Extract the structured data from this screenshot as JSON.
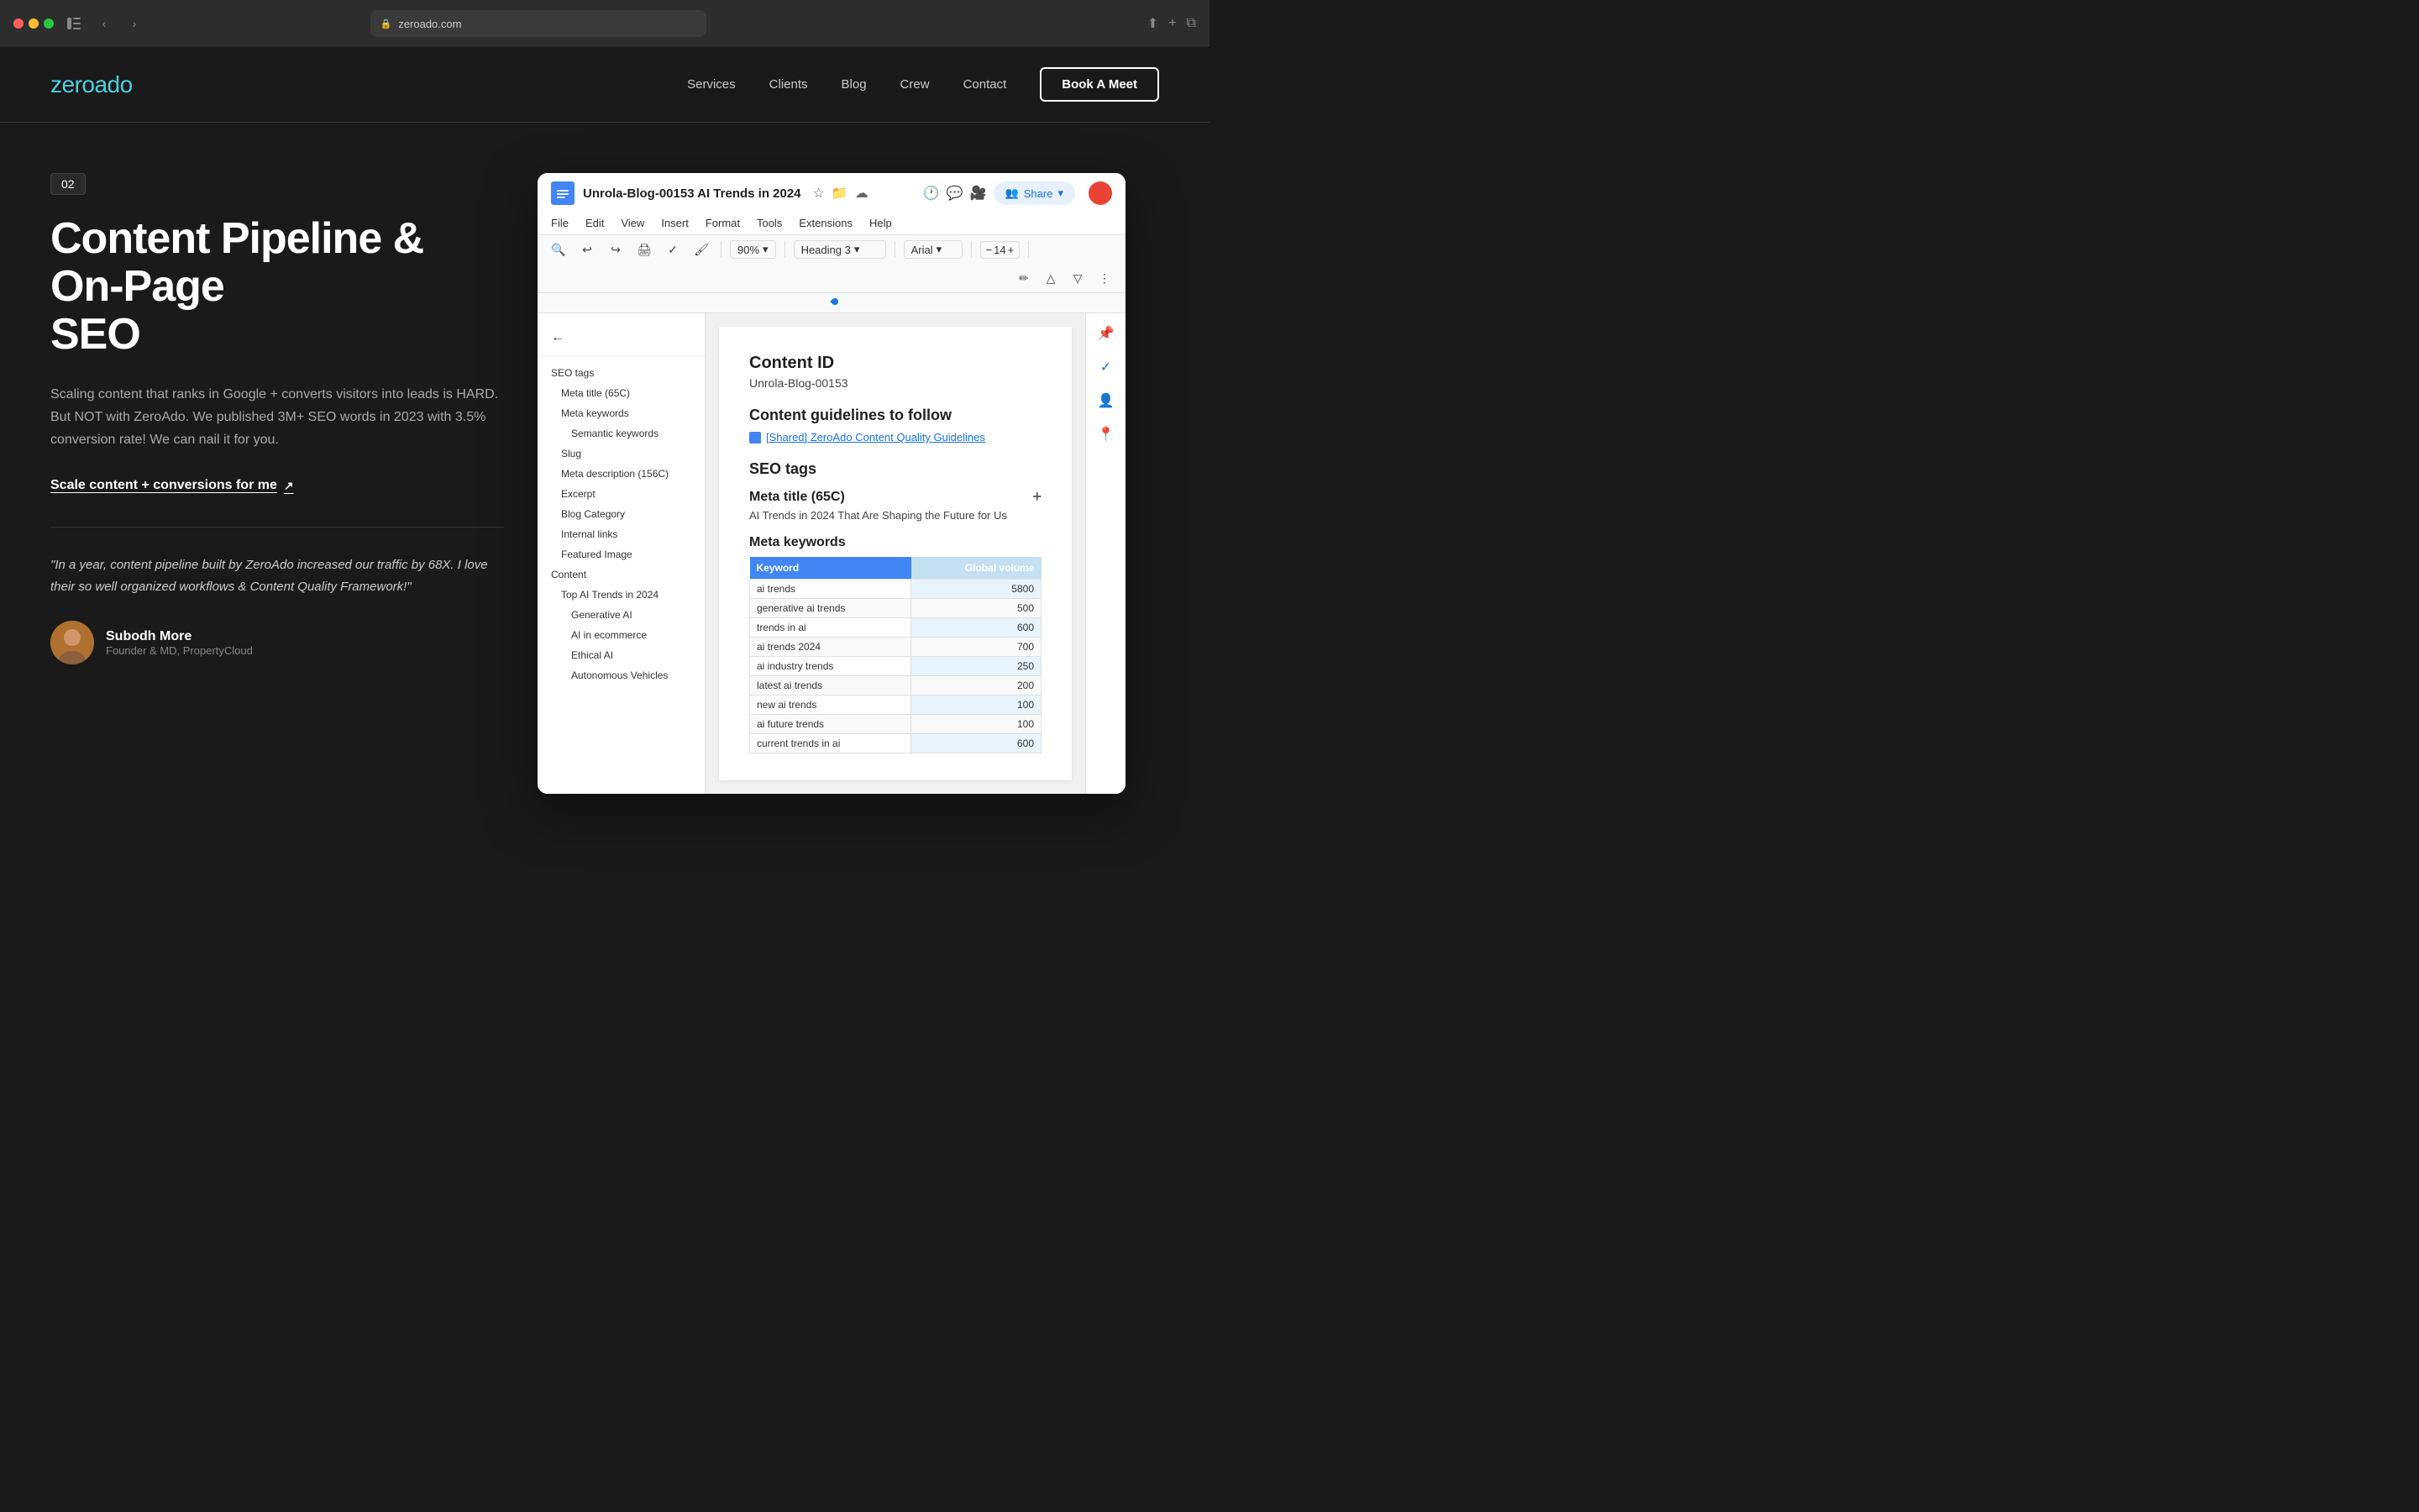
{
  "browser": {
    "url": "zeroado.com",
    "reload_label": "↻"
  },
  "nav": {
    "logo_zero": "zero",
    "logo_ado": "ado",
    "links": [
      "Services",
      "Clients",
      "Blog",
      "Crew",
      "Contact"
    ],
    "book_btn": "Book A Meet"
  },
  "section": {
    "number": "02",
    "title_line1": "Content Pipeline & On-Page",
    "title_line2": "SEO",
    "description": "Scaling content that ranks in Google + converts visitors into leads is HARD. But NOT with ZeroAdo. We published 3M+ SEO words in 2023 with 3.5% conversion rate! We can nail it for you.",
    "cta": "Scale content + conversions for me",
    "testimonial": "\"In a year, content pipeline built by ZeroAdo increased our traffic by 68X. I love their so well organized workflows & Content Quality Framework!\"",
    "author_name": "Subodh More",
    "author_title": "Founder & MD, PropertyCloud"
  },
  "gdoc": {
    "title": "Unrola-Blog-00153 AI Trends in 2024",
    "menu": [
      "File",
      "Edit",
      "View",
      "Insert",
      "Format",
      "Tools",
      "Extensions",
      "Help"
    ],
    "zoom": "90%",
    "style": "Heading 3",
    "font": "Arial",
    "font_size": "14",
    "share_btn": "Share",
    "content_id_label": "Content ID",
    "content_id_val": "Unrola-Blog-00153",
    "guidelines_label": "Content guidelines to follow",
    "guidelines_link": "[Shared] ZeroAdo Content Quality Guidelines",
    "seo_tags_label": "SEO tags",
    "meta_title_label": "Meta title (65C)",
    "meta_title_val": "AI Trends in 2024 That Are Shaping the Future for Us",
    "meta_keywords_label": "Meta keywords",
    "outline": {
      "items": [
        "SEO tags",
        "Meta title (65C)",
        "Meta keywords",
        "Semantic keywords",
        "Slug",
        "Meta description (156C)",
        "Excerpt",
        "Blog Category",
        "Internal links",
        "Featured Image",
        "Content",
        "Top AI Trends in 2024",
        "Generative AI",
        "AI in ecommerce",
        "Ethical AI",
        "Autonomous Vehicles"
      ]
    },
    "keywords_table": {
      "headers": [
        "Keyword",
        "Global volume"
      ],
      "rows": [
        [
          "ai trends",
          "5800"
        ],
        [
          "generative ai trends",
          "500"
        ],
        [
          "trends in ai",
          "600"
        ],
        [
          "ai trends 2024",
          "700"
        ],
        [
          "ai industry trends",
          "250"
        ],
        [
          "latest ai trends",
          "200"
        ],
        [
          "new ai trends",
          "100"
        ],
        [
          "ai future trends",
          "100"
        ],
        [
          "current trends in ai",
          "600"
        ]
      ]
    }
  }
}
